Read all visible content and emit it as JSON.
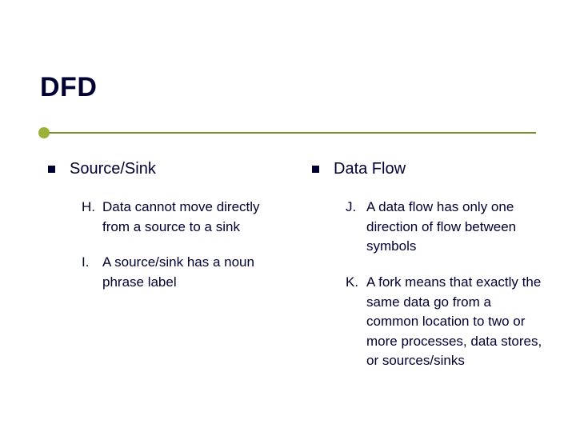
{
  "title": "DFD",
  "columns": [
    {
      "heading": "Source/Sink",
      "items": [
        {
          "marker": "H.",
          "text": "Data cannot move directly from a source to a sink"
        },
        {
          "marker": "I.",
          "text": "A source/sink has a noun phrase label"
        }
      ]
    },
    {
      "heading": "Data Flow",
      "items": [
        {
          "marker": "J.",
          "text": "A data flow has only one direction of flow between symbols"
        },
        {
          "marker": "K.",
          "text": "A fork means that exactly the same data go from a common location to two or more processes, data stores, or sources/sinks"
        }
      ]
    }
  ]
}
